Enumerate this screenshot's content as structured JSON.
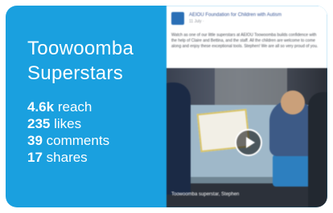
{
  "theme": {
    "accent": "#1aa0df"
  },
  "campaign": {
    "title_line1": "Toowoomba",
    "title_line2": "Superstars"
  },
  "metrics": [
    {
      "value": "4.6k",
      "label": "reach"
    },
    {
      "value": "235",
      "label": "likes"
    },
    {
      "value": "39",
      "label": "comments"
    },
    {
      "value": "17",
      "label": "shares"
    }
  ],
  "post": {
    "page_name": "AEIOU Foundation for Children with Autism",
    "meta": "11 July ·",
    "text": "Watch as one of our little superstars at AEIOU Toowoomba builds confidence with the help of Claire and Bettina, and the staff. All the children are welcome to come along and enjoy these exceptional tools. Stephen! We are all so very proud of you.",
    "play_icon": "play-icon",
    "video_caption": "Toowoomba superstar, Stephen"
  }
}
